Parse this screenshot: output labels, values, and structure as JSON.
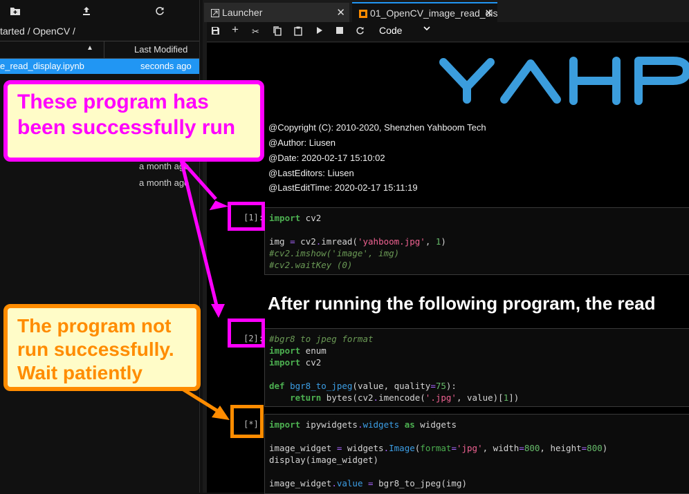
{
  "file_browser": {
    "toolbar_icons": [
      "new-folder-icon",
      "upload-icon",
      "refresh-icon"
    ],
    "breadcrumb": "tarted / OpenCV /",
    "columns": {
      "name": "",
      "last_modified": "Last Modified"
    },
    "files": [
      {
        "name": "e_read_display.ipynb",
        "modified": "seconds ago"
      }
    ],
    "other_dates": [
      "a month ago",
      "a month ago"
    ]
  },
  "tabs": [
    {
      "label": "Launcher",
      "icon": "launcher-icon"
    },
    {
      "label": "01_OpenCV_image_read_dis",
      "icon": "notebook-icon"
    }
  ],
  "notebook_toolbar": {
    "icons": [
      "save-icon",
      "add-cell-icon",
      "cut-icon",
      "copy-icon",
      "paste-icon",
      "run-icon",
      "stop-icon",
      "restart-icon"
    ],
    "cell_type": "Code"
  },
  "logo_text": "YAHB",
  "metadata": [
    "@Copyright (C): 2010-2020, Shenzhen Yahboom Tech",
    "@Author: Liusen",
    "@Date: 2020-02-17 15:10:02",
    "@LastEditors: Liusen",
    "@LastEditTime: 2020-02-17 15:11:19"
  ],
  "cells": [
    {
      "prompt": "[1]:"
    },
    {
      "prompt": "[2]:"
    },
    {
      "prompt": "[*]:"
    }
  ],
  "heading": "After running the following program, the read",
  "annotations": {
    "success": [
      "These program has",
      "been successfully run"
    ],
    "pending": [
      "The program not",
      "run successfully.",
      "Wait patiently"
    ],
    "colors": {
      "success": "#ff00ff",
      "pending": "#ff8c00",
      "callout_bg": "#fffcc8"
    }
  },
  "colors": {
    "accent": "#2196f3",
    "keyword": "#4caf50",
    "string": "#f06292",
    "comment": "#6a9955"
  }
}
